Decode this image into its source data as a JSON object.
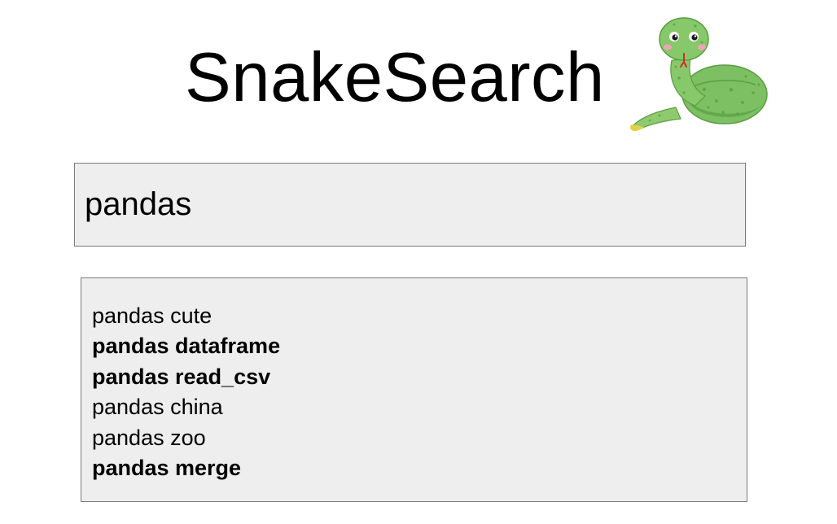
{
  "header": {
    "title": "SnakeSearch",
    "mascot_icon": "green-snake-mascot"
  },
  "search": {
    "value": "pandas"
  },
  "suggestions": [
    {
      "text": "pandas cute",
      "bold": false
    },
    {
      "text": "pandas dataframe",
      "bold": true
    },
    {
      "text": "pandas read_csv",
      "bold": true
    },
    {
      "text": "pandas china",
      "bold": false
    },
    {
      "text": "pandas zoo",
      "bold": false
    },
    {
      "text": "pandas merge",
      "bold": true
    }
  ],
  "colors": {
    "box_background": "#eeeeee",
    "box_border": "#7a7a7a",
    "snake_green": "#7cc063",
    "snake_dark": "#4f9a3a"
  }
}
